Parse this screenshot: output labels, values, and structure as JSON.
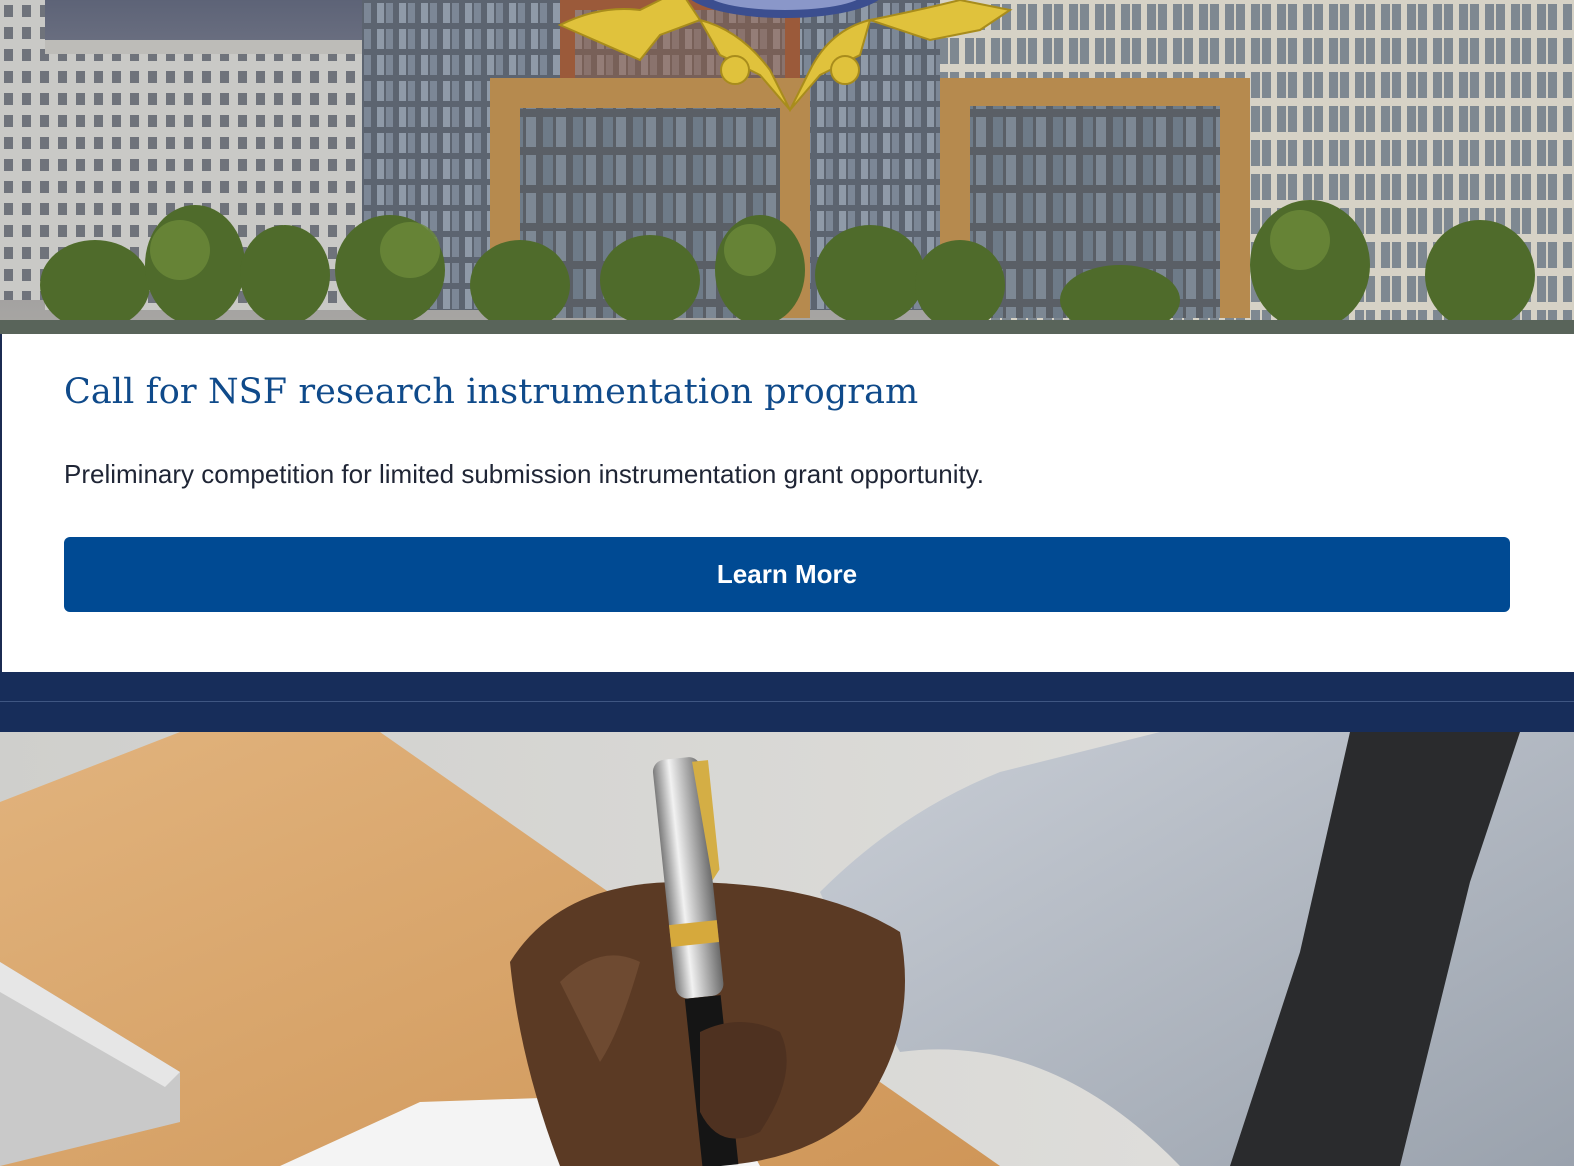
{
  "hero": {
    "image": "campus-buildings-image",
    "logo_icon": "gold-star-crest-icon"
  },
  "card": {
    "title": "Call for NSF research instrumentation program",
    "description": "Preliminary competition for limited submission instrumentation grant opportunity.",
    "button_label": "Learn More"
  },
  "photo": {
    "image": "hand-writing-with-pen-image"
  },
  "colors": {
    "title": "#0f4a8a",
    "button": "#004a93",
    "band": "#172d5a",
    "text": "#1f2535"
  }
}
